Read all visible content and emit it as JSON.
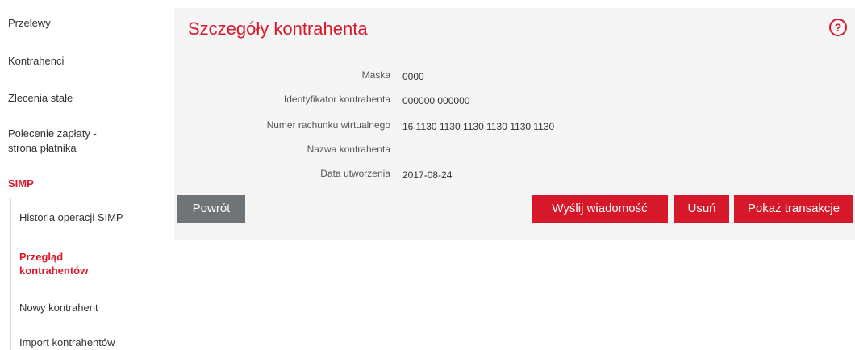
{
  "sidebar": {
    "items": [
      {
        "label": "Przelewy"
      },
      {
        "label": "Kontrahenci"
      },
      {
        "label": "Zlecenia stałe"
      },
      {
        "label": "Polecenie zapłaty -"
      },
      {
        "label": "strona płatnika"
      },
      {
        "label": "SIMP"
      }
    ],
    "subitems": [
      {
        "label": "Historia operacji SIMP"
      },
      {
        "label": "Przegląd"
      },
      {
        "label": "kontrahentów"
      },
      {
        "label": "Nowy kontrahent"
      },
      {
        "label": "Import kontrahentów"
      }
    ]
  },
  "panel": {
    "title": "Szczegóły kontrahenta",
    "help_symbol": "?",
    "fields": [
      {
        "label": "Maska",
        "value": "0000"
      },
      {
        "label": "Identyfikator kontrahenta",
        "value": "000000 000000"
      },
      {
        "label": "Numer rachunku wirtualnego",
        "value": "16 1130 1130 1130 1130 1130 1130"
      },
      {
        "label": "Nazwa kontrahenta",
        "value": ""
      },
      {
        "label": "Data utworzenia",
        "value": "2017-08-24"
      }
    ],
    "buttons": {
      "back": "Powrót",
      "send_message": "Wyślij wiadomość",
      "delete": "Usuń",
      "show_transactions": "Pokaż transakcje"
    }
  },
  "colors": {
    "accent": "#d7182a",
    "grey_button": "#6e7477",
    "panel_bg": "#f5f5f5"
  }
}
